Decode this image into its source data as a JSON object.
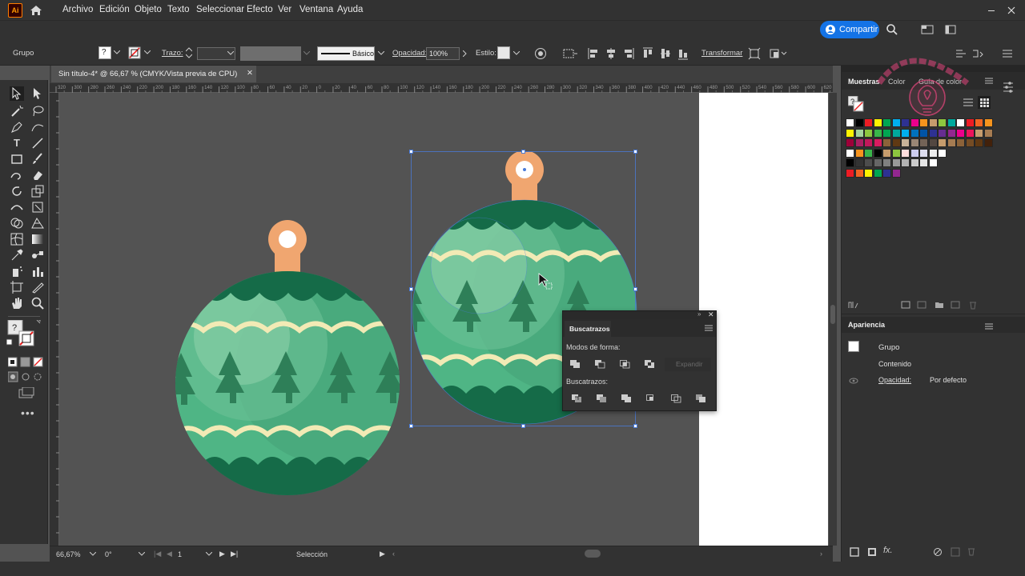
{
  "app": {
    "logo_text": "Ai"
  },
  "menu": [
    "Archivo",
    "Edición",
    "Objeto",
    "Texto",
    "Seleccionar",
    "Efecto",
    "Ver",
    "Ventana",
    "Ayuda"
  ],
  "share_label": "Compartir",
  "control": {
    "selection_type": "Grupo",
    "stroke_label": "Trazo:",
    "brush_label": "Básico",
    "opacity_label": "Opacidad:",
    "opacity_value": "100%",
    "style_label": "Estilo:",
    "transform_label": "Transformar",
    "fill_indicator": "?"
  },
  "document_tab": {
    "title": "Sin título-4* @ 66,67 % (CMYK/Vista previa de CPU)",
    "close": "✕"
  },
  "ruler_ticks": [
    "320",
    "300",
    "280",
    "260",
    "240",
    "220",
    "200",
    "180",
    "160",
    "140",
    "120",
    "100",
    "80",
    "60",
    "40",
    "20",
    "0",
    "20",
    "40",
    "60",
    "80",
    "100",
    "120",
    "140",
    "160",
    "180",
    "200",
    "220",
    "240",
    "260",
    "280",
    "300",
    "320",
    "340",
    "360",
    "380",
    "400",
    "420",
    "440",
    "460",
    "480",
    "500",
    "520",
    "540",
    "560",
    "580",
    "600",
    "620"
  ],
  "status": {
    "zoom": "66,67%",
    "rotation": "0°",
    "artboard_num": "1",
    "tool_name": "Selección"
  },
  "swatches_panel": {
    "tabs": [
      "Muestras",
      "Color",
      "Guía de color"
    ],
    "rows": [
      [
        "#ffffff",
        "#000000",
        "#ed1c24",
        "#fff200",
        "#00a651",
        "#00aeef",
        "#2e3192",
        "#ec008c",
        "#f7941d",
        "#c69c6d",
        "#8dc63f",
        "#00a99d",
        "#ffffff",
        "#ed1c24",
        "#f26522",
        "#f7941d"
      ],
      [
        "#fff200",
        "#a3d39c",
        "#8dc63f",
        "#39b54a",
        "#00a651",
        "#00a99d",
        "#00aeef",
        "#0072bc",
        "#0054a6",
        "#2e3192",
        "#662d91",
        "#92278f",
        "#ec008c",
        "#ed145b",
        "#c69c6d",
        "#a67c52"
      ],
      [
        "#9e0039",
        "#ab1e62",
        "#c2185b",
        "#d81b60",
        "#8c6239",
        "#603913",
        "#c7b299",
        "#998675",
        "#736357",
        "#534741",
        "#c69c6d",
        "#a67c52",
        "#8c6239",
        "#754c24",
        "#603913",
        "#42210b"
      ],
      [
        "#ffffff",
        "#f7941d",
        "#39b54a",
        "#000000",
        "#c69c6d",
        "#8dc63f",
        "#fdd",
        "#cce",
        "#dde",
        "#eee",
        "#ffffff"
      ],
      [
        "#000000",
        "#333333",
        "#4d4d4d",
        "#666666",
        "#808080",
        "#999999",
        "#b3b3b3",
        "#cccccc",
        "#e6e6e6",
        "#ffffff"
      ],
      [
        "#ed1c24",
        "#f26522",
        "#fff200",
        "#00a651",
        "#2e3192",
        "#92278f"
      ]
    ]
  },
  "appearance_panel": {
    "title": "Apariencia",
    "group_label": "Grupo",
    "content_label": "Contenido",
    "opacity_label": "Opacidad:",
    "opacity_value": "Por defecto"
  },
  "pathfinder_panel": {
    "title": "Buscatrazos",
    "shape_modes_label": "Modos de forma:",
    "expand_label": "Expandir",
    "pathfinders_label": "Buscatrazos:"
  },
  "colors": {
    "ornament_light": "#4fb585",
    "ornament_mid": "#3f9e74",
    "ornament_dark": "#156b48",
    "ornament_highlight": "#8fd2ac",
    "cap": "#f0a670",
    "ribbon": "#f2eab5",
    "tree": "#2e7f58",
    "selection": "#4a7bd8",
    "accent": "#1473e6",
    "watermark": "#e0457b"
  },
  "watermark": {
    "text": "Rincón de ideas"
  }
}
